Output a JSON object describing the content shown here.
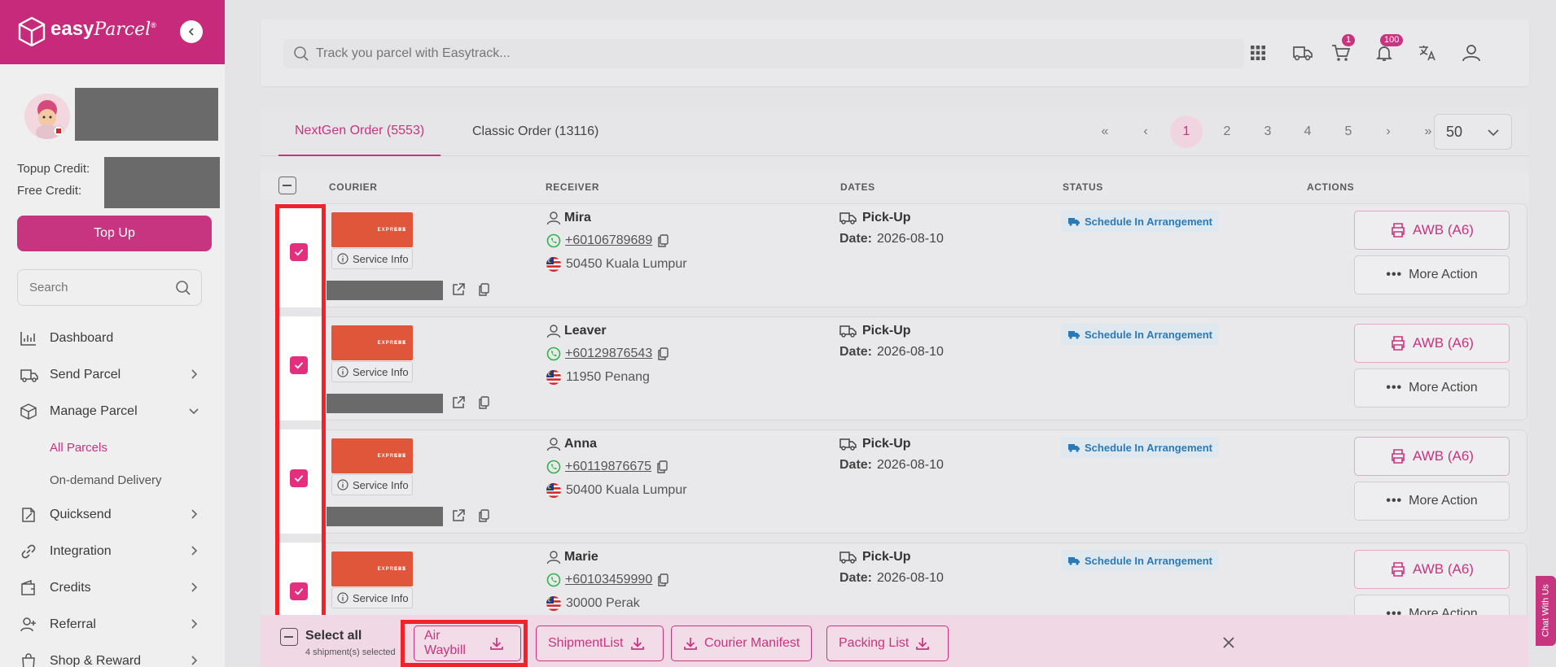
{
  "brand": {
    "name": "easy",
    "name_suffix": "Parcel",
    "reg": "®",
    "color": "#c72a7b"
  },
  "profile": {
    "topup_credit_label": "Topup Credit:",
    "free_credit_label": "Free Credit:",
    "topup_button": "Top Up"
  },
  "sidebar_search": {
    "placeholder": "Search"
  },
  "nav": {
    "dashboard": "Dashboard",
    "send_parcel": "Send Parcel",
    "manage_parcel": "Manage Parcel",
    "all_parcels": "All Parcels",
    "on_demand": "On-demand Delivery",
    "quicksend": "Quicksend",
    "integration": "Integration",
    "credits": "Credits",
    "referral": "Referral",
    "shop_reward": "Shop & Reward"
  },
  "topbar": {
    "track_placeholder": "Track you parcel with Easytrack...",
    "cart_count": "1",
    "notification_count": "100"
  },
  "tabs": {
    "nextgen": "NextGen Order (5553)",
    "classic": "Classic Order (13116)"
  },
  "pagination": {
    "first": "«",
    "prev": "‹",
    "pages": [
      "1",
      "2",
      "3",
      "4",
      "5"
    ],
    "current": 1,
    "next": "›",
    "last": "»",
    "per_page": "50"
  },
  "columns": {
    "courier": "COURIER",
    "receiver": "RECEIVER",
    "dates": "DATES",
    "status": "STATUS",
    "actions": "ACTIONS"
  },
  "rows": [
    {
      "courier_logo": "SPX",
      "courier_sub": "EXPRESS",
      "service_info": "Service Info",
      "name": "Mira",
      "phone": "+60106789689",
      "address": "50450 Kuala Lumpur",
      "date_type": "Pick-Up",
      "date_label": "Date:",
      "date": "2026-08-10",
      "status": "Schedule In Arrangement",
      "awb": "AWB (A6)",
      "more": "More Action"
    },
    {
      "courier_logo": "SPX",
      "courier_sub": "EXPRESS",
      "service_info": "Service Info",
      "name": "Leaver",
      "phone": "+60129876543",
      "address": "11950 Penang",
      "date_type": "Pick-Up",
      "date_label": "Date:",
      "date": "2026-08-10",
      "status": "Schedule In Arrangement",
      "awb": "AWB (A6)",
      "more": "More Action"
    },
    {
      "courier_logo": "SPX",
      "courier_sub": "EXPRESS",
      "service_info": "Service Info",
      "name": "Anna",
      "phone": "+60119876675",
      "address": "50400 Kuala Lumpur",
      "date_type": "Pick-Up",
      "date_label": "Date:",
      "date": "2026-08-10",
      "status": "Schedule In Arrangement",
      "awb": "AWB (A6)",
      "more": "More Action"
    },
    {
      "courier_logo": "SPX",
      "courier_sub": "EXPRESS",
      "service_info": "Service Info",
      "name": "Marie",
      "phone": "+60103459990",
      "address": "30000 Perak",
      "date_type": "Pick-Up",
      "date_label": "Date:",
      "date": "2026-08-10",
      "status": "Schedule In Arrangement",
      "awb": "AWB (A6)",
      "more": "More Action"
    }
  ],
  "action_bar": {
    "select_all": "Select all",
    "selected_count": "4 shipment(s) selected",
    "air_waybill": "Air Waybill",
    "shipment_list": "ShipmentList",
    "courier_manifest": "Courier Manifest",
    "packing_list": "Packing List"
  },
  "chat": {
    "label": "Chat With Us"
  },
  "colors": {
    "accent": "#c7347f",
    "status_blue": "#2a7ab8",
    "highlight_red": "#f0232a",
    "check_pink": "#e2307f"
  }
}
